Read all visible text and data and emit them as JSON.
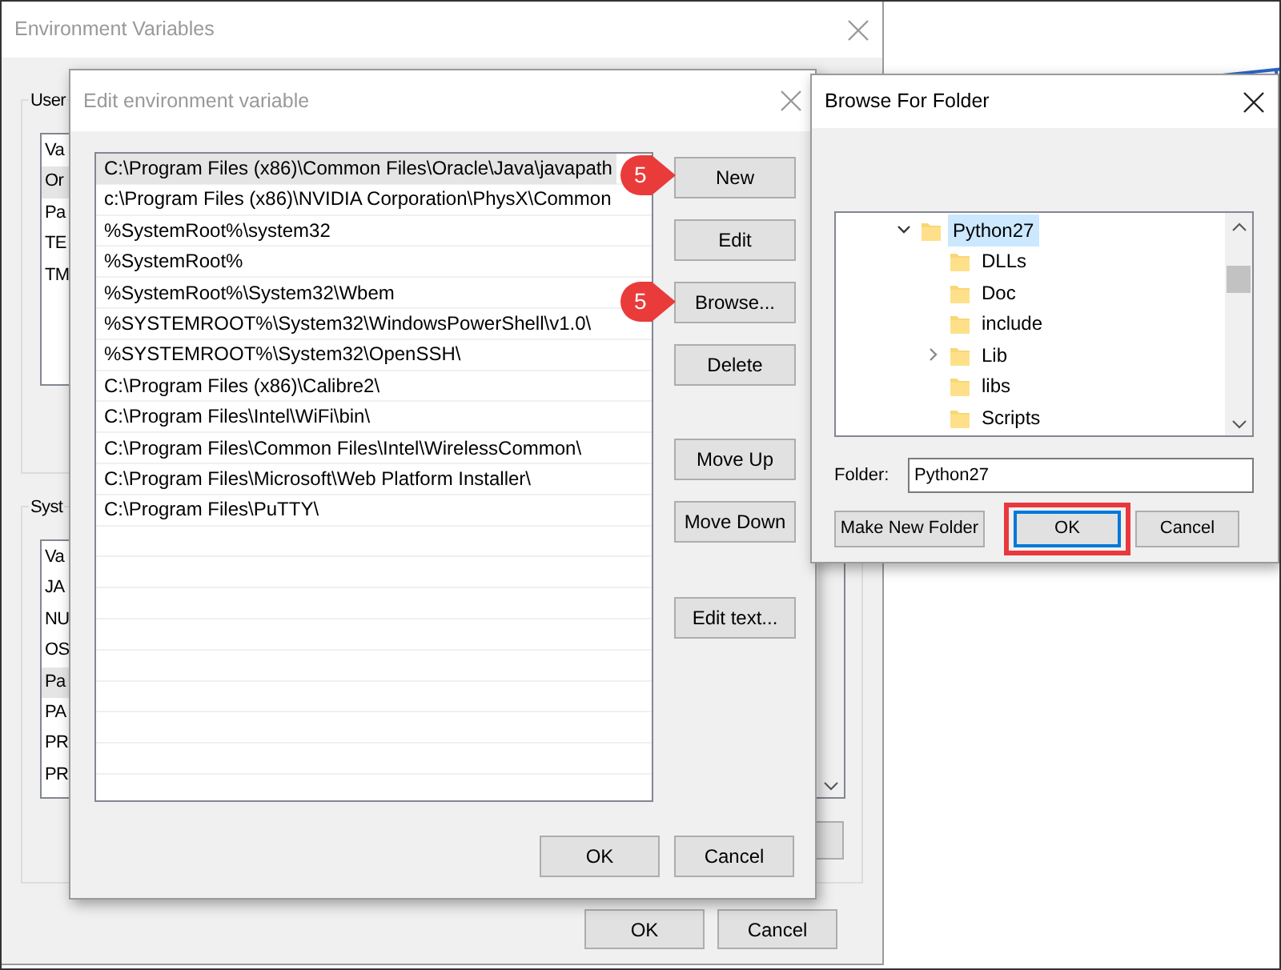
{
  "env_window": {
    "title": "Environment Variables",
    "active": false,
    "user_group": {
      "label": "User",
      "rows": [
        {
          "text": "Va",
          "selected": false
        },
        {
          "text": "Or",
          "selected": true
        },
        {
          "text": "Pa",
          "selected": false
        },
        {
          "text": "TE",
          "selected": false
        },
        {
          "text": "TM",
          "selected": false
        }
      ]
    },
    "system_group": {
      "label": "Syst",
      "rows": [
        {
          "text": "Va",
          "selected": false
        },
        {
          "text": "JA",
          "selected": false
        },
        {
          "text": "NU",
          "selected": false
        },
        {
          "text": "OS",
          "selected": false
        },
        {
          "text": "Pa",
          "selected": true
        },
        {
          "text": "PA",
          "selected": false
        },
        {
          "text": "PR",
          "selected": false
        },
        {
          "text": "PR",
          "selected": false
        }
      ]
    },
    "buttons": [
      "OK",
      "Cancel"
    ]
  },
  "edit_dialog": {
    "title": "Edit environment variable",
    "active": false,
    "paths": [
      {
        "text": "C:\\Program Files (x86)\\Common Files\\Oracle\\Java\\javapath",
        "selected": true
      },
      {
        "text": "c:\\Program Files (x86)\\NVIDIA Corporation\\PhysX\\Common",
        "selected": false
      },
      {
        "text": "%SystemRoot%\\system32",
        "selected": false
      },
      {
        "text": "%SystemRoot%",
        "selected": false
      },
      {
        "text": "%SystemRoot%\\System32\\Wbem",
        "selected": false
      },
      {
        "text": "%SYSTEMROOT%\\System32\\WindowsPowerShell\\v1.0\\",
        "selected": false
      },
      {
        "text": "%SYSTEMROOT%\\System32\\OpenSSH\\",
        "selected": false
      },
      {
        "text": "C:\\Program Files (x86)\\Calibre2\\",
        "selected": false
      },
      {
        "text": "C:\\Program Files\\Intel\\WiFi\\bin\\",
        "selected": false
      },
      {
        "text": "C:\\Program Files\\Common Files\\Intel\\WirelessCommon\\",
        "selected": false
      },
      {
        "text": "C:\\Program Files\\Microsoft\\Web Platform Installer\\",
        "selected": false
      },
      {
        "text": "C:\\Program Files\\PuTTY\\",
        "selected": false
      }
    ],
    "button_groups": [
      [
        "New",
        "Edit",
        "Browse...",
        "Delete"
      ],
      [
        "Move Up",
        "Move Down"
      ],
      [
        "Edit text..."
      ]
    ],
    "footer_buttons": [
      "OK",
      "Cancel"
    ]
  },
  "callouts": [
    {
      "label": "5"
    },
    {
      "label": "5"
    }
  ],
  "browse_dialog": {
    "title": "Browse For Folder",
    "active": true,
    "tree": [
      {
        "label": "Python27",
        "selected": true,
        "expanded": true,
        "children": [
          {
            "label": "DLLs",
            "selected": false
          },
          {
            "label": "Doc",
            "selected": false
          },
          {
            "label": "include",
            "selected": false
          },
          {
            "label": "Lib",
            "selected": false,
            "expanded": false
          },
          {
            "label": "libs",
            "selected": false
          },
          {
            "label": "Scripts",
            "selected": false
          }
        ]
      }
    ],
    "folder_label": "Folder:",
    "folder_value": "Python27",
    "buttons": [
      {
        "label": "Make New Folder",
        "default": false,
        "highlighted": false
      },
      {
        "label": "OK",
        "default": true,
        "highlighted": true
      },
      {
        "label": "Cancel",
        "default": false,
        "highlighted": false
      }
    ]
  }
}
